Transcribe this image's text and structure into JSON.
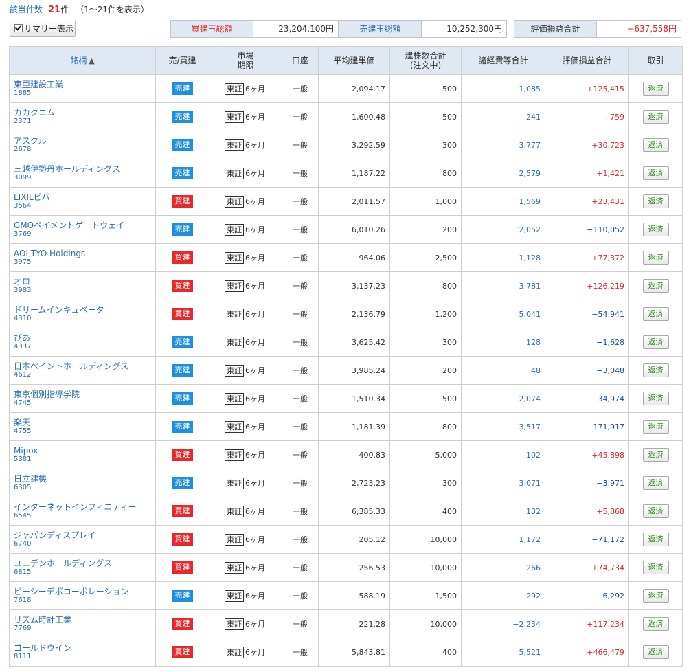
{
  "header": {
    "count_label": "該当件数",
    "count_value": "21",
    "count_unit": "件",
    "range_text": "（1〜21件を表示）",
    "summary_button": "サマリー表示"
  },
  "summary": {
    "buy_total_label": "買建玉総額",
    "buy_total_value": "23,204,100円",
    "sell_total_label": "売建玉総額",
    "sell_total_value": "10,252,300円",
    "pl_total_label": "評価損益合計",
    "pl_total_value": "+637,558円"
  },
  "columns": {
    "name": "銘柄",
    "sort_arrow": "▲",
    "side": "売/買建",
    "market_line1": "市場",
    "market_line2": "期限",
    "account": "口座",
    "avg_price": "平均建単価",
    "qty_line1": "建株数合計",
    "qty_line2": "(注文中)",
    "fees": "諸経費等合計",
    "pl": "評価損益合計",
    "action": "取引"
  },
  "row_labels": {
    "sell": "売建",
    "buy": "買建",
    "market": "東証",
    "term": "6ヶ月",
    "account": "一般",
    "close": "返済"
  },
  "colors": {
    "sell_badge": "#1f8fe0",
    "buy_badge": "#e8292c",
    "link_blue": "#2d6db5",
    "positive_red": "#e0262d",
    "negative_blue": "#1b4ea8",
    "header_bg": "#dfe8f3"
  },
  "rows": [
    {
      "name": "東亜建設工業",
      "code": "1885",
      "side": "sell",
      "avg": "2,094.17",
      "qty": "500",
      "fee": "1,085",
      "pl": "+125,415"
    },
    {
      "name": "カカクコム",
      "code": "2371",
      "side": "sell",
      "avg": "1,600.48",
      "qty": "500",
      "fee": "241",
      "pl": "+759"
    },
    {
      "name": "アスクル",
      "code": "2678",
      "side": "sell",
      "avg": "3,292.59",
      "qty": "300",
      "fee": "3,777",
      "pl": "+30,723"
    },
    {
      "name": "三越伊勢丹ホールディングス",
      "code": "3099",
      "side": "sell",
      "avg": "1,187.22",
      "qty": "800",
      "fee": "2,579",
      "pl": "+1,421"
    },
    {
      "name": "LIXILビバ",
      "code": "3564",
      "side": "buy",
      "avg": "2,011.57",
      "qty": "1,000",
      "fee": "1,569",
      "pl": "+23,431"
    },
    {
      "name": "GMOペイメントゲートウェイ",
      "code": "3769",
      "side": "sell",
      "avg": "6,010.26",
      "qty": "200",
      "fee": "2,052",
      "pl": "−110,052"
    },
    {
      "name": "AOI TYO Holdings",
      "code": "3975",
      "side": "buy",
      "avg": "964.06",
      "qty": "2,500",
      "fee": "1,128",
      "pl": "+77,372"
    },
    {
      "name": "オロ",
      "code": "3983",
      "side": "buy",
      "avg": "3,137.23",
      "qty": "800",
      "fee": "3,781",
      "pl": "+126,219"
    },
    {
      "name": "ドリームインキュベータ",
      "code": "4310",
      "side": "buy",
      "avg": "2,136.79",
      "qty": "1,200",
      "fee": "5,041",
      "pl": "−54,941"
    },
    {
      "name": "ぴあ",
      "code": "4337",
      "side": "sell",
      "avg": "3,625.42",
      "qty": "300",
      "fee": "128",
      "pl": "−1,628"
    },
    {
      "name": "日本ペイントホールディングス",
      "code": "4612",
      "side": "sell",
      "avg": "3,985.24",
      "qty": "200",
      "fee": "48",
      "pl": "−3,048"
    },
    {
      "name": "東京個別指導学院",
      "code": "4745",
      "side": "sell",
      "avg": "1,510.34",
      "qty": "500",
      "fee": "2,074",
      "pl": "−34,974"
    },
    {
      "name": "楽天",
      "code": "4755",
      "side": "sell",
      "avg": "1,181.39",
      "qty": "800",
      "fee": "3,517",
      "pl": "−171,917"
    },
    {
      "name": "Mipox",
      "code": "5381",
      "side": "buy",
      "avg": "400.83",
      "qty": "5,000",
      "fee": "102",
      "pl": "+45,898"
    },
    {
      "name": "日立建機",
      "code": "6305",
      "side": "sell",
      "avg": "2,723.23",
      "qty": "300",
      "fee": "3,071",
      "pl": "−3,971"
    },
    {
      "name": "インターネットインフィニティー",
      "code": "6545",
      "side": "buy",
      "avg": "6,385.33",
      "qty": "400",
      "fee": "132",
      "pl": "+5,868"
    },
    {
      "name": "ジャパンディスプレイ",
      "code": "6740",
      "side": "buy",
      "avg": "205.12",
      "qty": "10,000",
      "fee": "1,172",
      "pl": "−71,172"
    },
    {
      "name": "ユニデンホールディングス",
      "code": "6815",
      "side": "buy",
      "avg": "256.53",
      "qty": "10,000",
      "fee": "266",
      "pl": "+74,734"
    },
    {
      "name": "ピーシーデポコーポレーション",
      "code": "7618",
      "side": "sell",
      "avg": "588.19",
      "qty": "1,500",
      "fee": "292",
      "pl": "−6,292"
    },
    {
      "name": "リズム時計工業",
      "code": "7769",
      "side": "buy",
      "avg": "221.28",
      "qty": "10,000",
      "fee": "−2,234",
      "pl": "+117,234"
    },
    {
      "name": "ゴールドウイン",
      "code": "8111",
      "side": "buy",
      "avg": "5,843.81",
      "qty": "400",
      "fee": "5,521",
      "pl": "+466,479"
    }
  ]
}
